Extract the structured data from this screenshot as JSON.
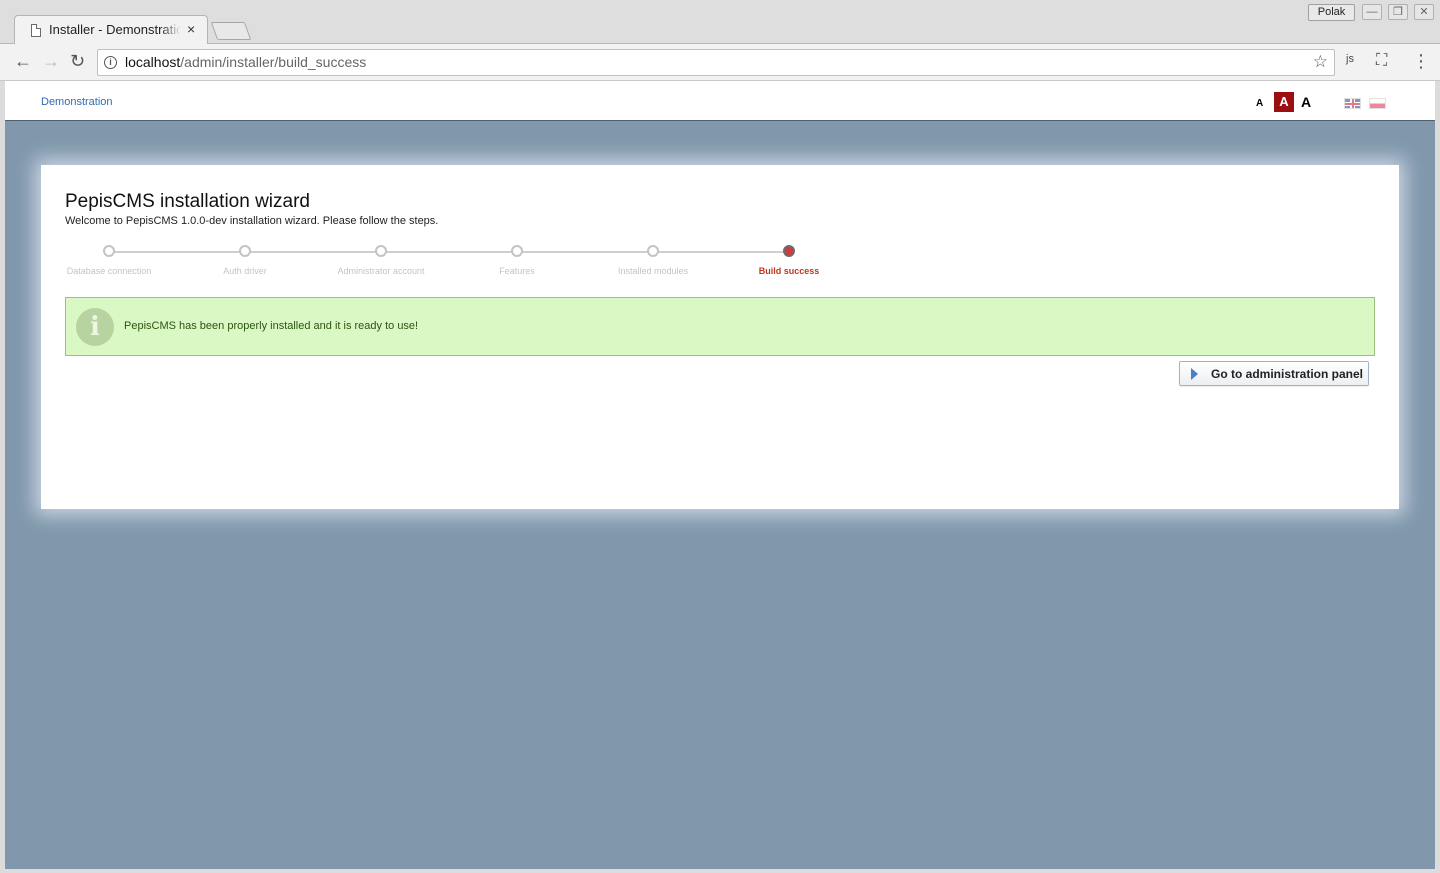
{
  "browser": {
    "tab_title": "Installer - Demonstration",
    "tab_close": "×",
    "profile": "Polak",
    "url_host": "localhost",
    "url_path": "/admin/installer/build_success",
    "info_glyph": "i",
    "star_glyph": "☆",
    "back_glyph": "←",
    "forward_glyph": "→",
    "reload_glyph": "↻",
    "menu_glyph": "⋮",
    "ext_js_label": "js",
    "cast_glyph": "⛶",
    "minimize_glyph": "—",
    "maximize_glyph": "❐",
    "close_glyph": "✕"
  },
  "header": {
    "brand": "Demonstration",
    "font_sizes": [
      "A",
      "A",
      "A"
    ],
    "languages": [
      "english-flag-icon",
      "polish-flag-icon"
    ]
  },
  "wizard": {
    "title": "PepisCMS installation wizard",
    "subtitle": "Welcome to PepisCMS 1.0.0-dev installation wizard. Please follow the steps.",
    "steps": [
      {
        "label": "Database connection",
        "active": false
      },
      {
        "label": "Auth driver",
        "active": false
      },
      {
        "label": "Administrator account",
        "active": false
      },
      {
        "label": "Features",
        "active": false
      },
      {
        "label": "Installed modules",
        "active": false
      },
      {
        "label": "Build success",
        "active": true
      }
    ],
    "alert_icon": "i",
    "alert_text": "PepisCMS has been properly installed and it is ready to use!",
    "button_label": "Go to administration panel"
  },
  "colors": {
    "page_bg": "#8198ac",
    "active_step": "#c0371e",
    "success_bg": "#daf8c4",
    "font_size_active": "#9b0f10",
    "link": "#2d6cb3"
  }
}
